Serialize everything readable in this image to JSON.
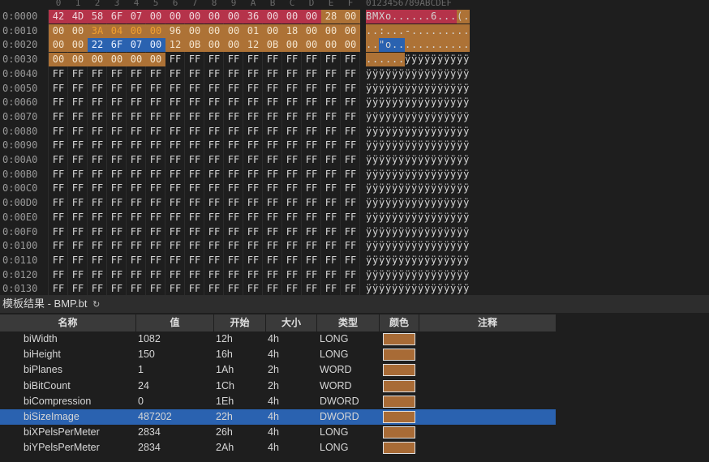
{
  "hex_header": [
    "0",
    "1",
    "2",
    "3",
    "4",
    "5",
    "6",
    "7",
    "8",
    "9",
    "A",
    "B",
    "C",
    "D",
    "E",
    "F"
  ],
  "ascii_header": "0123456789ABCDEF",
  "rows": [
    {
      "addr": "0:0000",
      "bytes": [
        "42",
        "4D",
        "58",
        "6F",
        "07",
        "00",
        "00",
        "00",
        "00",
        "00",
        "36",
        "00",
        "00",
        "00",
        "28",
        "00"
      ],
      "ascii": "BMXo......6...(."
    },
    {
      "addr": "0:0010",
      "bytes": [
        "00",
        "00",
        "3A",
        "04",
        "00",
        "00",
        "96",
        "00",
        "00",
        "00",
        "01",
        "00",
        "18",
        "00",
        "00",
        "00"
      ],
      "ascii": "..:...-........."
    },
    {
      "addr": "0:0020",
      "bytes": [
        "00",
        "00",
        "22",
        "6F",
        "07",
        "00",
        "12",
        "0B",
        "00",
        "00",
        "12",
        "0B",
        "00",
        "00",
        "00",
        "00"
      ],
      "ascii": "..\"o............"
    },
    {
      "addr": "0:0030",
      "bytes": [
        "00",
        "00",
        "00",
        "00",
        "00",
        "00",
        "FF",
        "FF",
        "FF",
        "FF",
        "FF",
        "FF",
        "FF",
        "FF",
        "FF",
        "FF"
      ],
      "ascii": "......ÿÿÿÿÿÿÿÿÿÿ"
    },
    {
      "addr": "0:0040",
      "bytes": [
        "FF",
        "FF",
        "FF",
        "FF",
        "FF",
        "FF",
        "FF",
        "FF",
        "FF",
        "FF",
        "FF",
        "FF",
        "FF",
        "FF",
        "FF",
        "FF"
      ],
      "ascii": "ÿÿÿÿÿÿÿÿÿÿÿÿÿÿÿÿ"
    },
    {
      "addr": "0:0050",
      "bytes": [
        "FF",
        "FF",
        "FF",
        "FF",
        "FF",
        "FF",
        "FF",
        "FF",
        "FF",
        "FF",
        "FF",
        "FF",
        "FF",
        "FF",
        "FF",
        "FF"
      ],
      "ascii": "ÿÿÿÿÿÿÿÿÿÿÿÿÿÿÿÿ"
    },
    {
      "addr": "0:0060",
      "bytes": [
        "FF",
        "FF",
        "FF",
        "FF",
        "FF",
        "FF",
        "FF",
        "FF",
        "FF",
        "FF",
        "FF",
        "FF",
        "FF",
        "FF",
        "FF",
        "FF"
      ],
      "ascii": "ÿÿÿÿÿÿÿÿÿÿÿÿÿÿÿÿ"
    },
    {
      "addr": "0:0070",
      "bytes": [
        "FF",
        "FF",
        "FF",
        "FF",
        "FF",
        "FF",
        "FF",
        "FF",
        "FF",
        "FF",
        "FF",
        "FF",
        "FF",
        "FF",
        "FF",
        "FF"
      ],
      "ascii": "ÿÿÿÿÿÿÿÿÿÿÿÿÿÿÿÿ"
    },
    {
      "addr": "0:0080",
      "bytes": [
        "FF",
        "FF",
        "FF",
        "FF",
        "FF",
        "FF",
        "FF",
        "FF",
        "FF",
        "FF",
        "FF",
        "FF",
        "FF",
        "FF",
        "FF",
        "FF"
      ],
      "ascii": "ÿÿÿÿÿÿÿÿÿÿÿÿÿÿÿÿ"
    },
    {
      "addr": "0:0090",
      "bytes": [
        "FF",
        "FF",
        "FF",
        "FF",
        "FF",
        "FF",
        "FF",
        "FF",
        "FF",
        "FF",
        "FF",
        "FF",
        "FF",
        "FF",
        "FF",
        "FF"
      ],
      "ascii": "ÿÿÿÿÿÿÿÿÿÿÿÿÿÿÿÿ"
    },
    {
      "addr": "0:00A0",
      "bytes": [
        "FF",
        "FF",
        "FF",
        "FF",
        "FF",
        "FF",
        "FF",
        "FF",
        "FF",
        "FF",
        "FF",
        "FF",
        "FF",
        "FF",
        "FF",
        "FF"
      ],
      "ascii": "ÿÿÿÿÿÿÿÿÿÿÿÿÿÿÿÿ"
    },
    {
      "addr": "0:00B0",
      "bytes": [
        "FF",
        "FF",
        "FF",
        "FF",
        "FF",
        "FF",
        "FF",
        "FF",
        "FF",
        "FF",
        "FF",
        "FF",
        "FF",
        "FF",
        "FF",
        "FF"
      ],
      "ascii": "ÿÿÿÿÿÿÿÿÿÿÿÿÿÿÿÿ"
    },
    {
      "addr": "0:00C0",
      "bytes": [
        "FF",
        "FF",
        "FF",
        "FF",
        "FF",
        "FF",
        "FF",
        "FF",
        "FF",
        "FF",
        "FF",
        "FF",
        "FF",
        "FF",
        "FF",
        "FF"
      ],
      "ascii": "ÿÿÿÿÿÿÿÿÿÿÿÿÿÿÿÿ"
    },
    {
      "addr": "0:00D0",
      "bytes": [
        "FF",
        "FF",
        "FF",
        "FF",
        "FF",
        "FF",
        "FF",
        "FF",
        "FF",
        "FF",
        "FF",
        "FF",
        "FF",
        "FF",
        "FF",
        "FF"
      ],
      "ascii": "ÿÿÿÿÿÿÿÿÿÿÿÿÿÿÿÿ"
    },
    {
      "addr": "0:00E0",
      "bytes": [
        "FF",
        "FF",
        "FF",
        "FF",
        "FF",
        "FF",
        "FF",
        "FF",
        "FF",
        "FF",
        "FF",
        "FF",
        "FF",
        "FF",
        "FF",
        "FF"
      ],
      "ascii": "ÿÿÿÿÿÿÿÿÿÿÿÿÿÿÿÿ"
    },
    {
      "addr": "0:00F0",
      "bytes": [
        "FF",
        "FF",
        "FF",
        "FF",
        "FF",
        "FF",
        "FF",
        "FF",
        "FF",
        "FF",
        "FF",
        "FF",
        "FF",
        "FF",
        "FF",
        "FF"
      ],
      "ascii": "ÿÿÿÿÿÿÿÿÿÿÿÿÿÿÿÿ"
    },
    {
      "addr": "0:0100",
      "bytes": [
        "FF",
        "FF",
        "FF",
        "FF",
        "FF",
        "FF",
        "FF",
        "FF",
        "FF",
        "FF",
        "FF",
        "FF",
        "FF",
        "FF",
        "FF",
        "FF"
      ],
      "ascii": "ÿÿÿÿÿÿÿÿÿÿÿÿÿÿÿÿ"
    },
    {
      "addr": "0:0110",
      "bytes": [
        "FF",
        "FF",
        "FF",
        "FF",
        "FF",
        "FF",
        "FF",
        "FF",
        "FF",
        "FF",
        "FF",
        "FF",
        "FF",
        "FF",
        "FF",
        "FF"
      ],
      "ascii": "ÿÿÿÿÿÿÿÿÿÿÿÿÿÿÿÿ"
    },
    {
      "addr": "0:0120",
      "bytes": [
        "FF",
        "FF",
        "FF",
        "FF",
        "FF",
        "FF",
        "FF",
        "FF",
        "FF",
        "FF",
        "FF",
        "FF",
        "FF",
        "FF",
        "FF",
        "FF"
      ],
      "ascii": "ÿÿÿÿÿÿÿÿÿÿÿÿÿÿÿÿ"
    },
    {
      "addr": "0:0130",
      "bytes": [
        "FF",
        "FF",
        "FF",
        "FF",
        "FF",
        "FF",
        "FF",
        "FF",
        "FF",
        "FF",
        "FF",
        "FF",
        "FF",
        "FF",
        "FF",
        "FF"
      ],
      "ascii": "ÿÿÿÿÿÿÿÿÿÿÿÿÿÿÿÿ"
    }
  ],
  "highlight_ranges": [
    {
      "start": 0,
      "end": 1,
      "color": "#b5334a",
      "text": "#f0d6dc"
    },
    {
      "start": 2,
      "end": 5,
      "color": "#b5334a",
      "text": "#f0d6dc"
    },
    {
      "start": 6,
      "end": 9,
      "color": "#b5334a",
      "text": "#f0d6dc"
    },
    {
      "start": 10,
      "end": 13,
      "color": "#b5334a",
      "text": "#f0d6dc"
    },
    {
      "start": 14,
      "end": 17,
      "color": "#ad7236",
      "text": "#f3e3cc"
    },
    {
      "start": 18,
      "end": 21,
      "color": "#ad7236",
      "text": "#f0a030"
    },
    {
      "start": 22,
      "end": 25,
      "color": "#ad7236",
      "text": "#f3e3cc"
    },
    {
      "start": 26,
      "end": 27,
      "color": "#ad7236",
      "text": "#f3e3cc"
    },
    {
      "start": 28,
      "end": 29,
      "color": "#ad7236",
      "text": "#f3e3cc"
    },
    {
      "start": 30,
      "end": 33,
      "color": "#ad7236",
      "text": "#f3e3cc"
    },
    {
      "start": 34,
      "end": 37,
      "color": "#2a62b0",
      "text": "#e8f0ff"
    },
    {
      "start": 38,
      "end": 41,
      "color": "#ad7236",
      "text": "#f3e3cc"
    },
    {
      "start": 42,
      "end": 45,
      "color": "#ad7236",
      "text": "#f3e3cc"
    },
    {
      "start": 46,
      "end": 49,
      "color": "#ad7236",
      "text": "#f3e3cc"
    },
    {
      "start": 50,
      "end": 53,
      "color": "#ad7236",
      "text": "#f3e3cc"
    }
  ],
  "template_panel": {
    "title": "模板结果 - BMP.bt",
    "refresh_icon": "↻",
    "columns": [
      "名称",
      "值",
      "开始",
      "大小",
      "类型",
      "颜色",
      "注释"
    ],
    "rows": [
      {
        "name": "biWidth",
        "value": "1082",
        "start": "12h",
        "size": "4h",
        "type": "LONG",
        "selected": false
      },
      {
        "name": "biHeight",
        "value": "150",
        "start": "16h",
        "size": "4h",
        "type": "LONG",
        "selected": false
      },
      {
        "name": "biPlanes",
        "value": "1",
        "start": "1Ah",
        "size": "2h",
        "type": "WORD",
        "selected": false
      },
      {
        "name": "biBitCount",
        "value": "24",
        "start": "1Ch",
        "size": "2h",
        "type": "WORD",
        "selected": false
      },
      {
        "name": "biCompression",
        "value": "0",
        "start": "1Eh",
        "size": "4h",
        "type": "DWORD",
        "selected": false
      },
      {
        "name": "biSizeImage",
        "value": "487202",
        "start": "22h",
        "size": "4h",
        "type": "DWORD",
        "selected": true
      },
      {
        "name": "biXPelsPerMeter",
        "value": "2834",
        "start": "26h",
        "size": "4h",
        "type": "LONG",
        "selected": false
      },
      {
        "name": "biYPelsPerMeter",
        "value": "2834",
        "start": "2Ah",
        "size": "4h",
        "type": "LONG",
        "selected": false
      }
    ],
    "swatch_color": "#a86b36"
  }
}
